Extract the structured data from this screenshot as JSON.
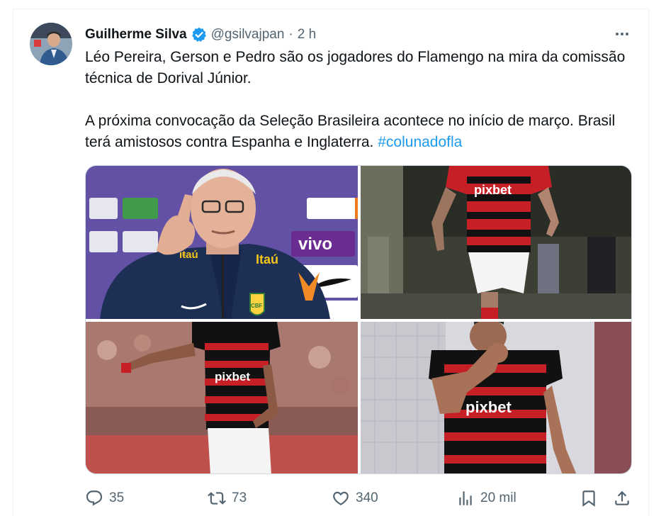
{
  "tweet": {
    "author": {
      "name": "Guilherme Silva",
      "handle": "@gsilvajpan",
      "verified": true
    },
    "separator": "·",
    "time": "2 h",
    "text": {
      "paragraph1": "Léo Pereira, Gerson e Pedro são os jogadores do Flamengo na mira da comissão técnica de Dorival Júnior.",
      "paragraph2": "A próxima convocação da Seleção Brasileira acontece no início de março. Brasil terá amistosos contra Espanha e Inglaterra.",
      "hashtag": "#colunadofla"
    },
    "media": [
      {
        "description": "coach-press-conference-photo",
        "sponsor_text": [
          "Itaú",
          "vivo"
        ]
      },
      {
        "description": "flamengo-player-running-photo",
        "sponsor_text": [
          "pixbet"
        ]
      },
      {
        "description": "flamengo-player-celebrating-photo",
        "sponsor_text": [
          "pixbet"
        ]
      },
      {
        "description": "flamengo-player-smiling-photo",
        "sponsor_text": [
          "pixbet"
        ]
      }
    ],
    "actions": {
      "replies": "35",
      "retweets": "73",
      "likes": "340",
      "views": "20 mil"
    },
    "colors": {
      "accent": "#1d9bf0",
      "text": "#0f1419",
      "secondary": "#536471",
      "flamengo_red": "#d61e24",
      "flamengo_black": "#1a1a1a"
    }
  }
}
